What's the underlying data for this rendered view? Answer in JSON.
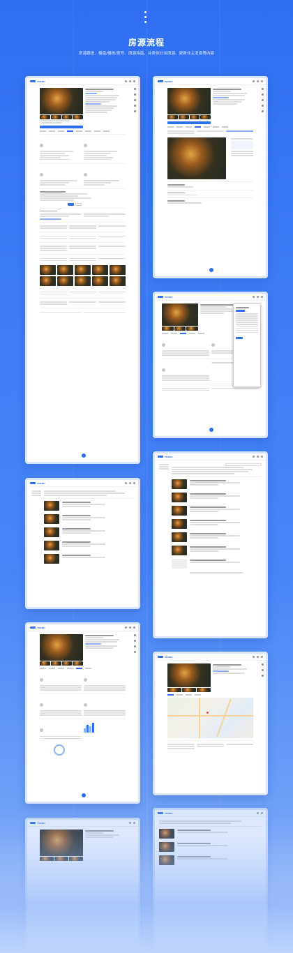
{
  "header": {
    "title": "房源流程",
    "subtitle": "房源跟进、楼盘/楼栋/室号、房源持盘、业务体分派房源、更新业主消息等内容"
  },
  "app": {
    "logo_text": "TOPKU"
  },
  "colors": {
    "background_top": "#2f6ef1",
    "background_bottom": "#b9d0fb",
    "accent": "#2f6ef1",
    "card_border": "#d8e5fd"
  },
  "icons": [
    "more-vertical-icon",
    "user-avatar-icon",
    "map-pin-icon",
    "floating-action-icon"
  ]
}
